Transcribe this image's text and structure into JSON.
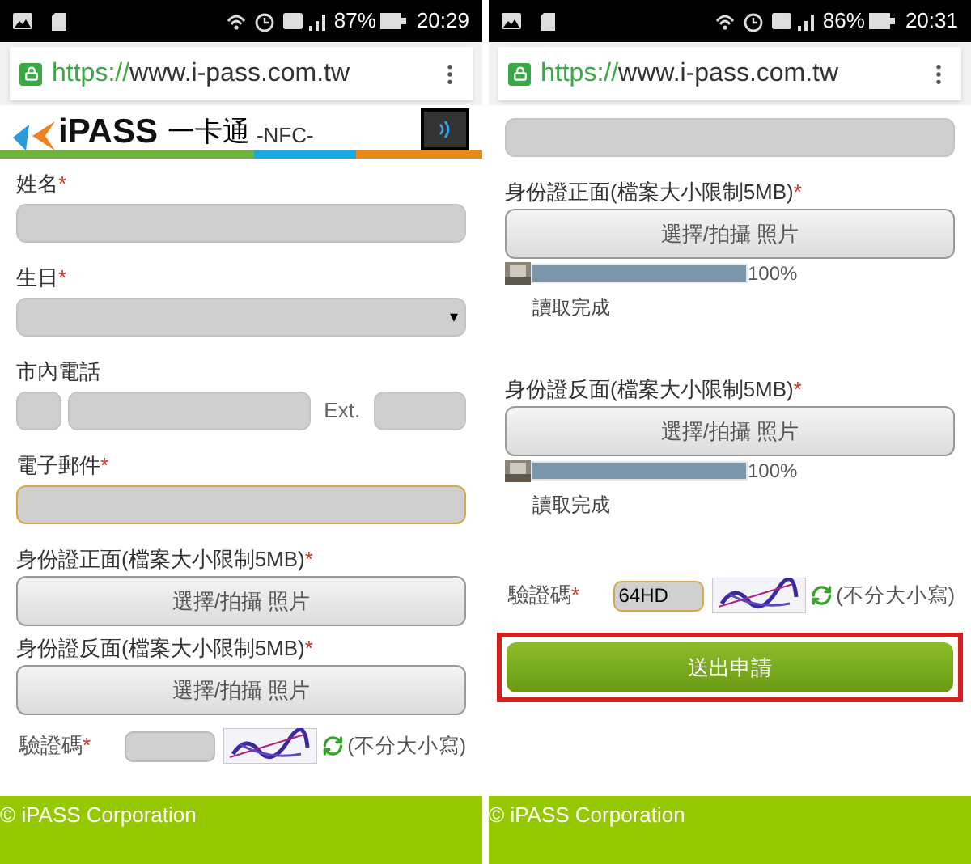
{
  "screens": [
    {
      "status_bar": {
        "battery": "87%",
        "time": "20:29"
      },
      "address_bar": {
        "scheme": "https://",
        "host": "www.i-pass.com.tw"
      },
      "banner": {
        "brand": "iPASS",
        "name": "一卡通",
        "tag": "-NFC-"
      },
      "form": [
        {
          "kind": "text",
          "label": "姓名",
          "mark": "*",
          "focused": false
        },
        {
          "kind": "select",
          "label": "生日",
          "mark": "*",
          "caret": "▾"
        },
        {
          "kind": "phone",
          "label": "市內電話",
          "ext": "Ext."
        },
        {
          "kind": "text",
          "label": "電子郵件",
          "mark": "*",
          "focused": true
        },
        {
          "kind": "file",
          "label": "身份證正面(檔案大小限制5MB)",
          "mark": "*",
          "button": "選擇/拍攝 照片"
        },
        {
          "kind": "file",
          "label": "身份證反面(檔案大小限制5MB)",
          "mark": "*",
          "button": "選擇/拍攝 照片"
        },
        {
          "kind": "captcha",
          "label": "驗證碼",
          "mark": "*",
          "note": "(不分大小寫)",
          "focused": false
        }
      ],
      "footer": "© iPASS Corporation"
    },
    {
      "status_bar": {
        "battery": "86%",
        "time": "20:31"
      },
      "address_bar": {
        "scheme": "https://",
        "host": "www.i-pass.com.tw"
      },
      "form": [
        {
          "kind": "text",
          "focused": false
        },
        {
          "kind": "file",
          "label": "身份證正面(檔案大小限制5MB)",
          "mark": "*",
          "button": "選擇/拍攝 照片",
          "upload": {
            "level": 1,
            "percent": "100%",
            "status": "讀取完成"
          }
        },
        {
          "kind": "file",
          "label": "身份證反面(檔案大小限制5MB)",
          "mark": "*",
          "button": "選擇/拍攝 照片",
          "upload": {
            "level": 1,
            "percent": "100%",
            "status": "讀取完成"
          }
        },
        {
          "kind": "captcha",
          "label": "驗證碼",
          "mark": "*",
          "value": "64HD",
          "note": "(不分大小寫)",
          "focused": true
        },
        {
          "kind": "submit",
          "label": "送出申請",
          "highlighted": true
        }
      ],
      "footer": "© iPASS Corporation"
    }
  ]
}
